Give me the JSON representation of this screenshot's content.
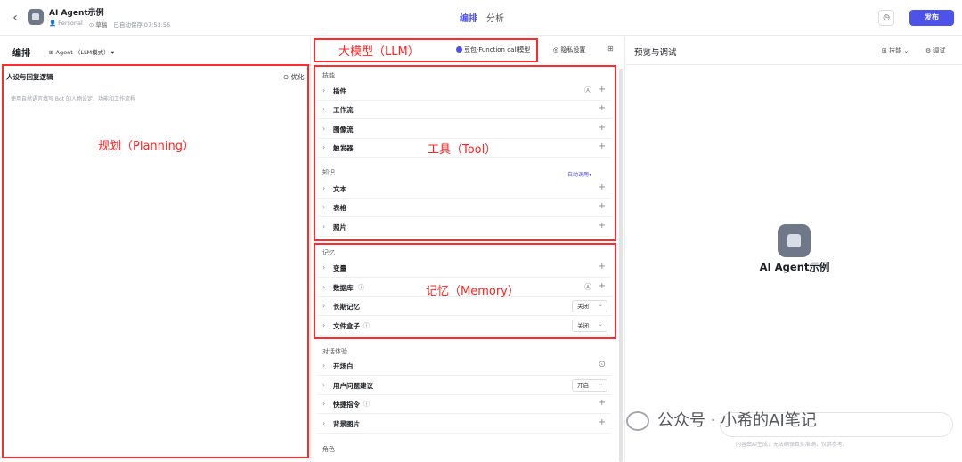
{
  "header": {
    "app_title": "AI Agent示例",
    "workspace": "Personal",
    "status": "草稿",
    "autosave": "已自动保存 07:53:56",
    "tabs": [
      "编排",
      "分析"
    ],
    "publish_label": "发布"
  },
  "left": {
    "title": "编排",
    "mode": "⊞ Agent  （LLM模式）  ▾",
    "prompt_title": "人设与回复逻辑",
    "optimize_label": "⊙ 优化",
    "prompt_placeholder": "使用自然语言填写 Bot 的人物设定、功能和工作流程",
    "annotation": "规划（Planning）"
  },
  "middle": {
    "llm_annotation": "大模型（LLM）",
    "model_name": "豆包·Function call模型",
    "privacy_label": "◎ 隐私设置",
    "skills": {
      "title": "技能",
      "items": [
        "插件",
        "工作流",
        "图像流",
        "触发器"
      ]
    },
    "tool_annotation": "工具（Tool）",
    "knowledge": {
      "title": "知识",
      "auto_call": "自动调用▾",
      "items": [
        "文本",
        "表格",
        "照片"
      ]
    },
    "memory": {
      "title": "记忆",
      "items": [
        {
          "name": "变量"
        },
        {
          "name": "数据库"
        },
        {
          "name": "长期记忆",
          "value": "关闭"
        },
        {
          "name": "文件盒子",
          "value": "关闭"
        }
      ]
    },
    "memory_annotation": "记忆（Memory）",
    "dialog": {
      "title": "对话体验",
      "items": [
        {
          "name": "开场白"
        },
        {
          "name": "用户问题建议",
          "value": "开启"
        },
        {
          "name": "快捷指令"
        },
        {
          "name": "背景图片"
        }
      ]
    },
    "role_title": "角色"
  },
  "right": {
    "title": "预览与调试",
    "skill_label": "技能 ⌄",
    "debug_label": "调试",
    "bot_name": "AI Agent示例",
    "watermark": "公众号 · 小希的AI笔记",
    "footnote": "内容由AI生成，无法确保真实准确，仅供参考。"
  },
  "colors": {
    "accent": "#4d53e8",
    "annotation_red": "#ff2a2a"
  }
}
